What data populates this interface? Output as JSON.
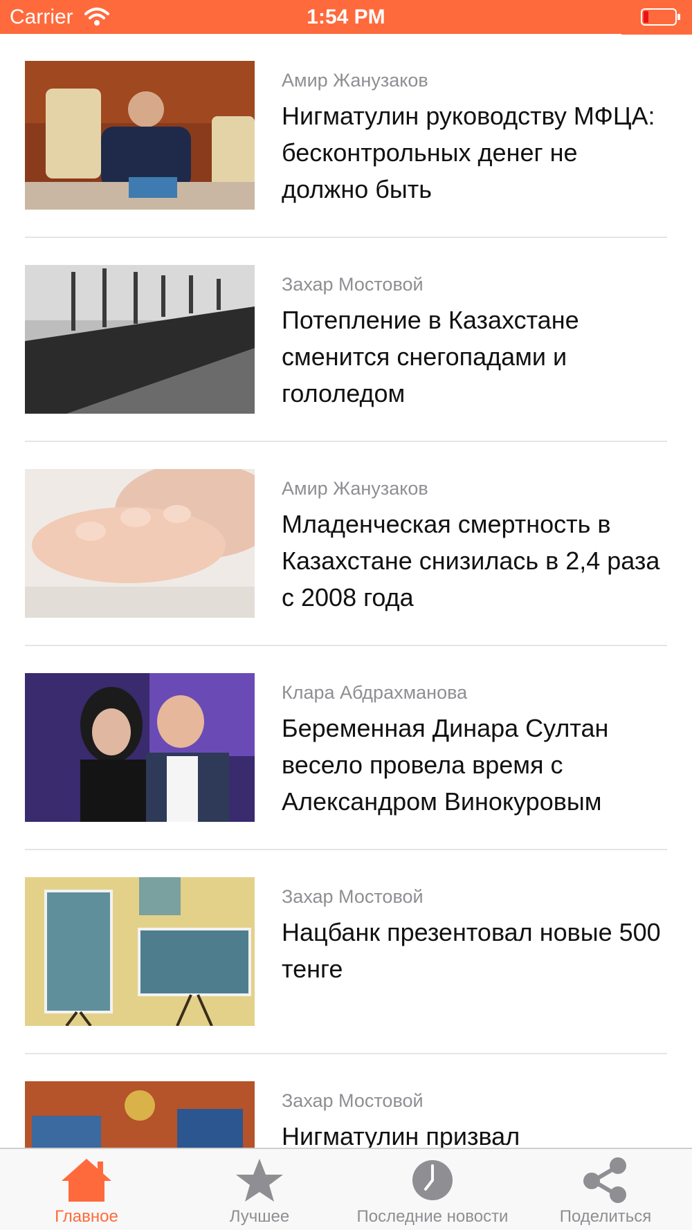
{
  "status_bar": {
    "carrier": "Carrier",
    "time": "1:54 PM"
  },
  "articles": [
    {
      "author": "Амир Жанузаков",
      "title": "Нигматулин руководству МФЦА: бесконтрольных денег не должно быть"
    },
    {
      "author": "Захар Мостовой",
      "title": "Потепление в Казахстане сменится снегопадами и гололедом"
    },
    {
      "author": "Амир Жанузаков",
      "title": "Младенческая смертность в Казахстане снизилась в 2,4 раза с 2008 года"
    },
    {
      "author": "Клара Абдрахманова",
      "title": "Беременная Динара Султан весело провела время с Александром Винокуровым"
    },
    {
      "author": "Захар Мостовой",
      "title": "Нацбанк презентовал новые 500 тенге"
    },
    {
      "author": "Захар Мостовой",
      "title": "Нигматулин призвал"
    }
  ],
  "tab_bar": {
    "tabs": [
      {
        "label": "Главное",
        "icon": "home-icon",
        "active": true
      },
      {
        "label": "Лучшее",
        "icon": "star-icon",
        "active": false
      },
      {
        "label": "Последние новости",
        "icon": "clock-icon",
        "active": false
      },
      {
        "label": "Поделиться",
        "icon": "share-icon",
        "active": false
      }
    ]
  },
  "colors": {
    "accent": "#FF6A3C",
    "inactive": "#8e8e93",
    "divider": "#e5e5e5"
  }
}
